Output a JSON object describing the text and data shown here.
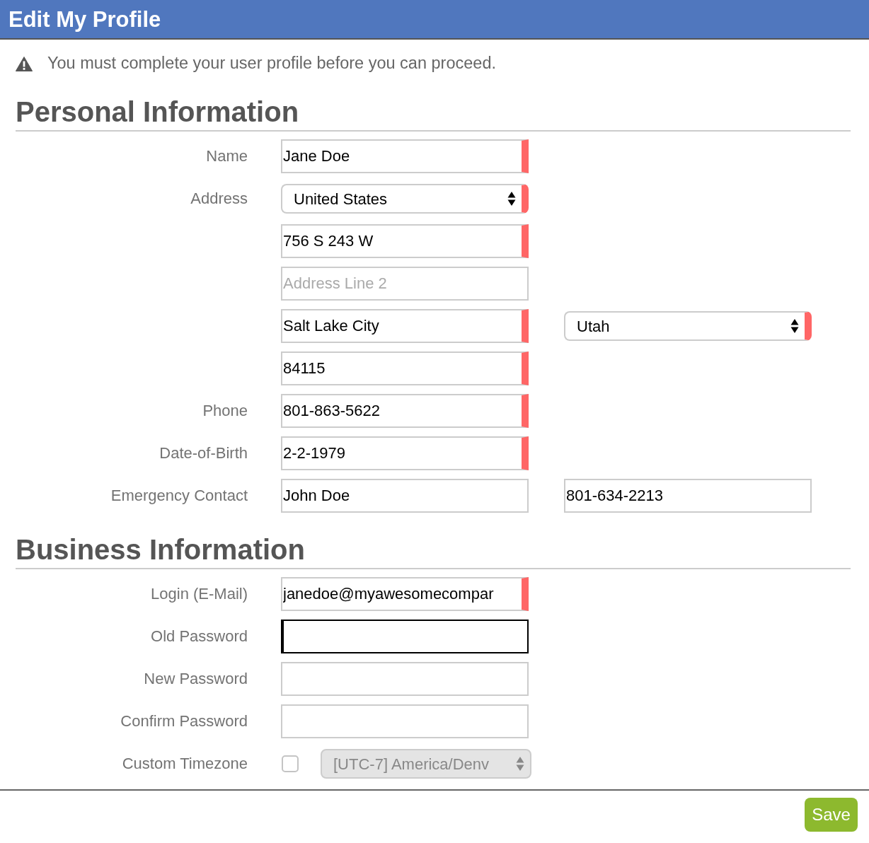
{
  "window": {
    "title": "Edit My Profile"
  },
  "notice": {
    "text": "You must complete your user profile before you can proceed."
  },
  "sections": [
    {
      "title": "Personal Information",
      "rows": [
        {
          "label": "Name",
          "fields": [
            {
              "kind": "text",
              "value": "Jane Doe",
              "required": true,
              "focused": false
            }
          ]
        },
        {
          "label": "Address",
          "fields": [
            {
              "kind": "select",
              "value": "United States",
              "required": true,
              "disabled": false
            }
          ]
        },
        {
          "fields": [
            {
              "kind": "text",
              "value": "756 S 243 W",
              "required": true,
              "focused": false
            }
          ]
        },
        {
          "fields": [
            {
              "kind": "text",
              "placeholder": "Address Line 2",
              "required": false,
              "focused": false
            }
          ]
        },
        {
          "fields": [
            {
              "kind": "text",
              "value": "Salt Lake City",
              "required": true,
              "focused": false
            },
            {
              "kind": "select",
              "value": "Utah",
              "required": true,
              "disabled": false
            }
          ]
        },
        {
          "fields": [
            {
              "kind": "text",
              "value": "84115",
              "required": true,
              "focused": false
            }
          ]
        },
        {
          "label": "Phone",
          "fields": [
            {
              "kind": "text",
              "value": "801-863-5622",
              "required": true,
              "focused": false
            }
          ]
        },
        {
          "label": "Date-of-Birth",
          "fields": [
            {
              "kind": "text",
              "value": "2-2-1979",
              "required": true,
              "focused": false
            }
          ]
        },
        {
          "label": "Emergency Contact",
          "fields": [
            {
              "kind": "text",
              "value": "John Doe",
              "required": false,
              "focused": false
            },
            {
              "kind": "text",
              "value": "801-634-2213",
              "required": false,
              "focused": false
            }
          ]
        }
      ]
    },
    {
      "title": "Business Information",
      "rows": [
        {
          "label": "Login (E-Mail)",
          "fields": [
            {
              "kind": "text",
              "value": "janedoe@myawesomecompar",
              "required": true,
              "focused": false
            }
          ]
        },
        {
          "label": "Old Password",
          "fields": [
            {
              "kind": "password",
              "required": false,
              "focused": true
            }
          ]
        },
        {
          "label": "New Password",
          "fields": [
            {
              "kind": "password",
              "required": false,
              "focused": false
            }
          ]
        },
        {
          "label": "Confirm Password",
          "fields": [
            {
              "kind": "password",
              "required": false,
              "focused": false
            }
          ]
        },
        {
          "label": "Custom Timezone",
          "fields": [
            {
              "kind": "checkbox",
              "checked": false
            },
            {
              "kind": "select",
              "value": "[UTC-7] America/Denv",
              "required": false,
              "disabled": true
            }
          ]
        }
      ]
    }
  ],
  "footer": {
    "save_button": "Save"
  }
}
